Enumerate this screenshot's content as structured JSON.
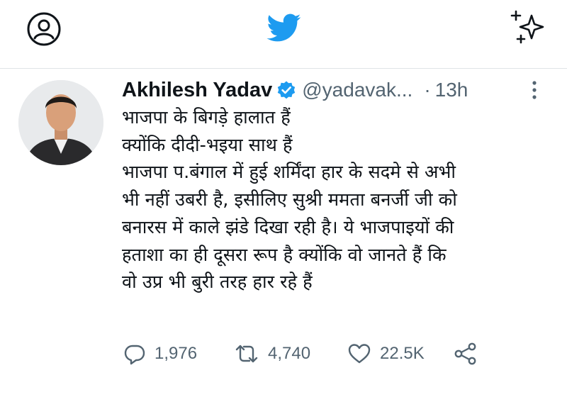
{
  "topbar": {
    "profile_icon": "profile-icon",
    "logo_icon": "twitter-bird-icon",
    "sparkle_icon": "sparkle-icon",
    "brand_color": "#1d9bf0"
  },
  "tweet": {
    "author_name": "Akhilesh Yadav",
    "verified_icon": "verified-badge-icon",
    "handle": "@yadavak...",
    "separator": "·",
    "time": "13h",
    "more_icon": "more-vertical-icon",
    "lines": [
      "भाजपा के बिगड़े हालात हैं",
      "क्योंकि दीदी-भइया साथ हैं",
      "भाजपा प.बंगाल में हुई शर्मिंदा हार के सदमे से अभी",
      "भी नहीं उबरी है, इसीलिए सुश्री ममता बनर्जी जी को",
      "बनारस में काले झंडे दिखा रही है। ये भाजपाइयों की",
      "हताशा का ही दूसरा रूप है क्योंकि वो जानते हैं कि",
      "वो उप्र भी बुरी तरह हार रहे हैं"
    ],
    "actions": {
      "reply_count": "1,976",
      "retweet_count": "4,740",
      "like_count": "22.5K",
      "reply_icon": "reply-icon",
      "retweet_icon": "retweet-icon",
      "like_icon": "heart-icon",
      "share_icon": "share-icon"
    }
  }
}
